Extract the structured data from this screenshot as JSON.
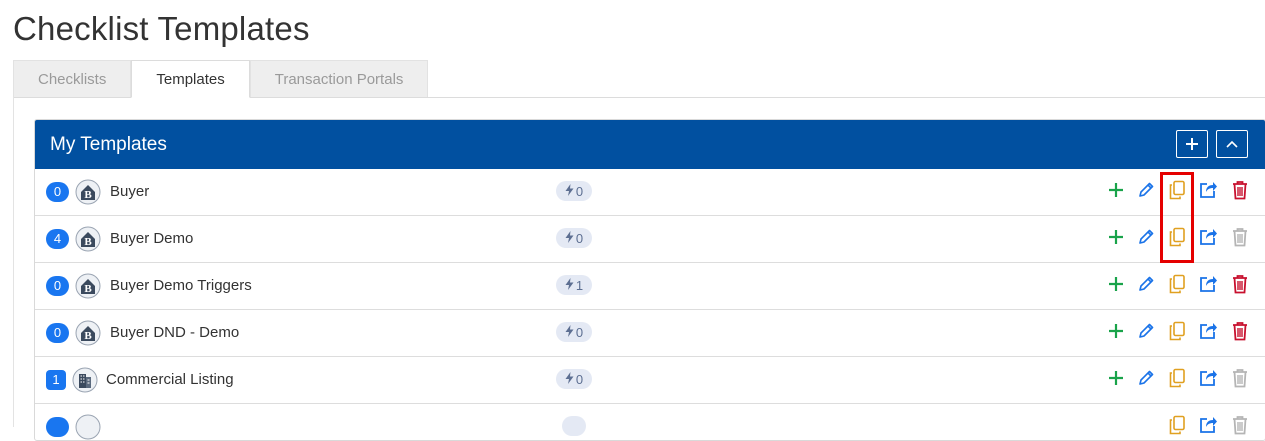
{
  "page": {
    "title": "Checklist Templates"
  },
  "tabs": [
    {
      "label": "Checklists",
      "active": false
    },
    {
      "label": "Templates",
      "active": true
    },
    {
      "label": "Transaction Portals",
      "active": false
    }
  ],
  "card": {
    "title": "My Templates",
    "add_icon": "plus-icon",
    "collapse_icon": "chevron-up-icon",
    "header_color": "#0150a0"
  },
  "rows": [
    {
      "count": "0",
      "name": "Buyer",
      "triggers": "0",
      "avatar": "buyer-house-icon",
      "delete_enabled": true
    },
    {
      "count": "4",
      "name": "Buyer Demo",
      "triggers": "0",
      "avatar": "buyer-house-icon",
      "delete_enabled": false
    },
    {
      "count": "0",
      "name": "Buyer Demo Triggers",
      "triggers": "1",
      "avatar": "buyer-house-icon",
      "delete_enabled": true
    },
    {
      "count": "0",
      "name": "Buyer DND - Demo",
      "triggers": "0",
      "avatar": "buyer-house-icon",
      "delete_enabled": true
    },
    {
      "count": "1",
      "name": "Commercial Listing",
      "triggers": "0",
      "avatar": "commercial-building-icon",
      "delete_enabled": false
    }
  ],
  "colors": {
    "count_badge": "#1976f0",
    "add": "#19a34a",
    "edit": "#1a73e8",
    "copy": "#e0a020",
    "share": "#1a73e8",
    "delete": "#c8102e",
    "delete_disabled": "#b5b5b5",
    "highlight": "#e50000"
  }
}
